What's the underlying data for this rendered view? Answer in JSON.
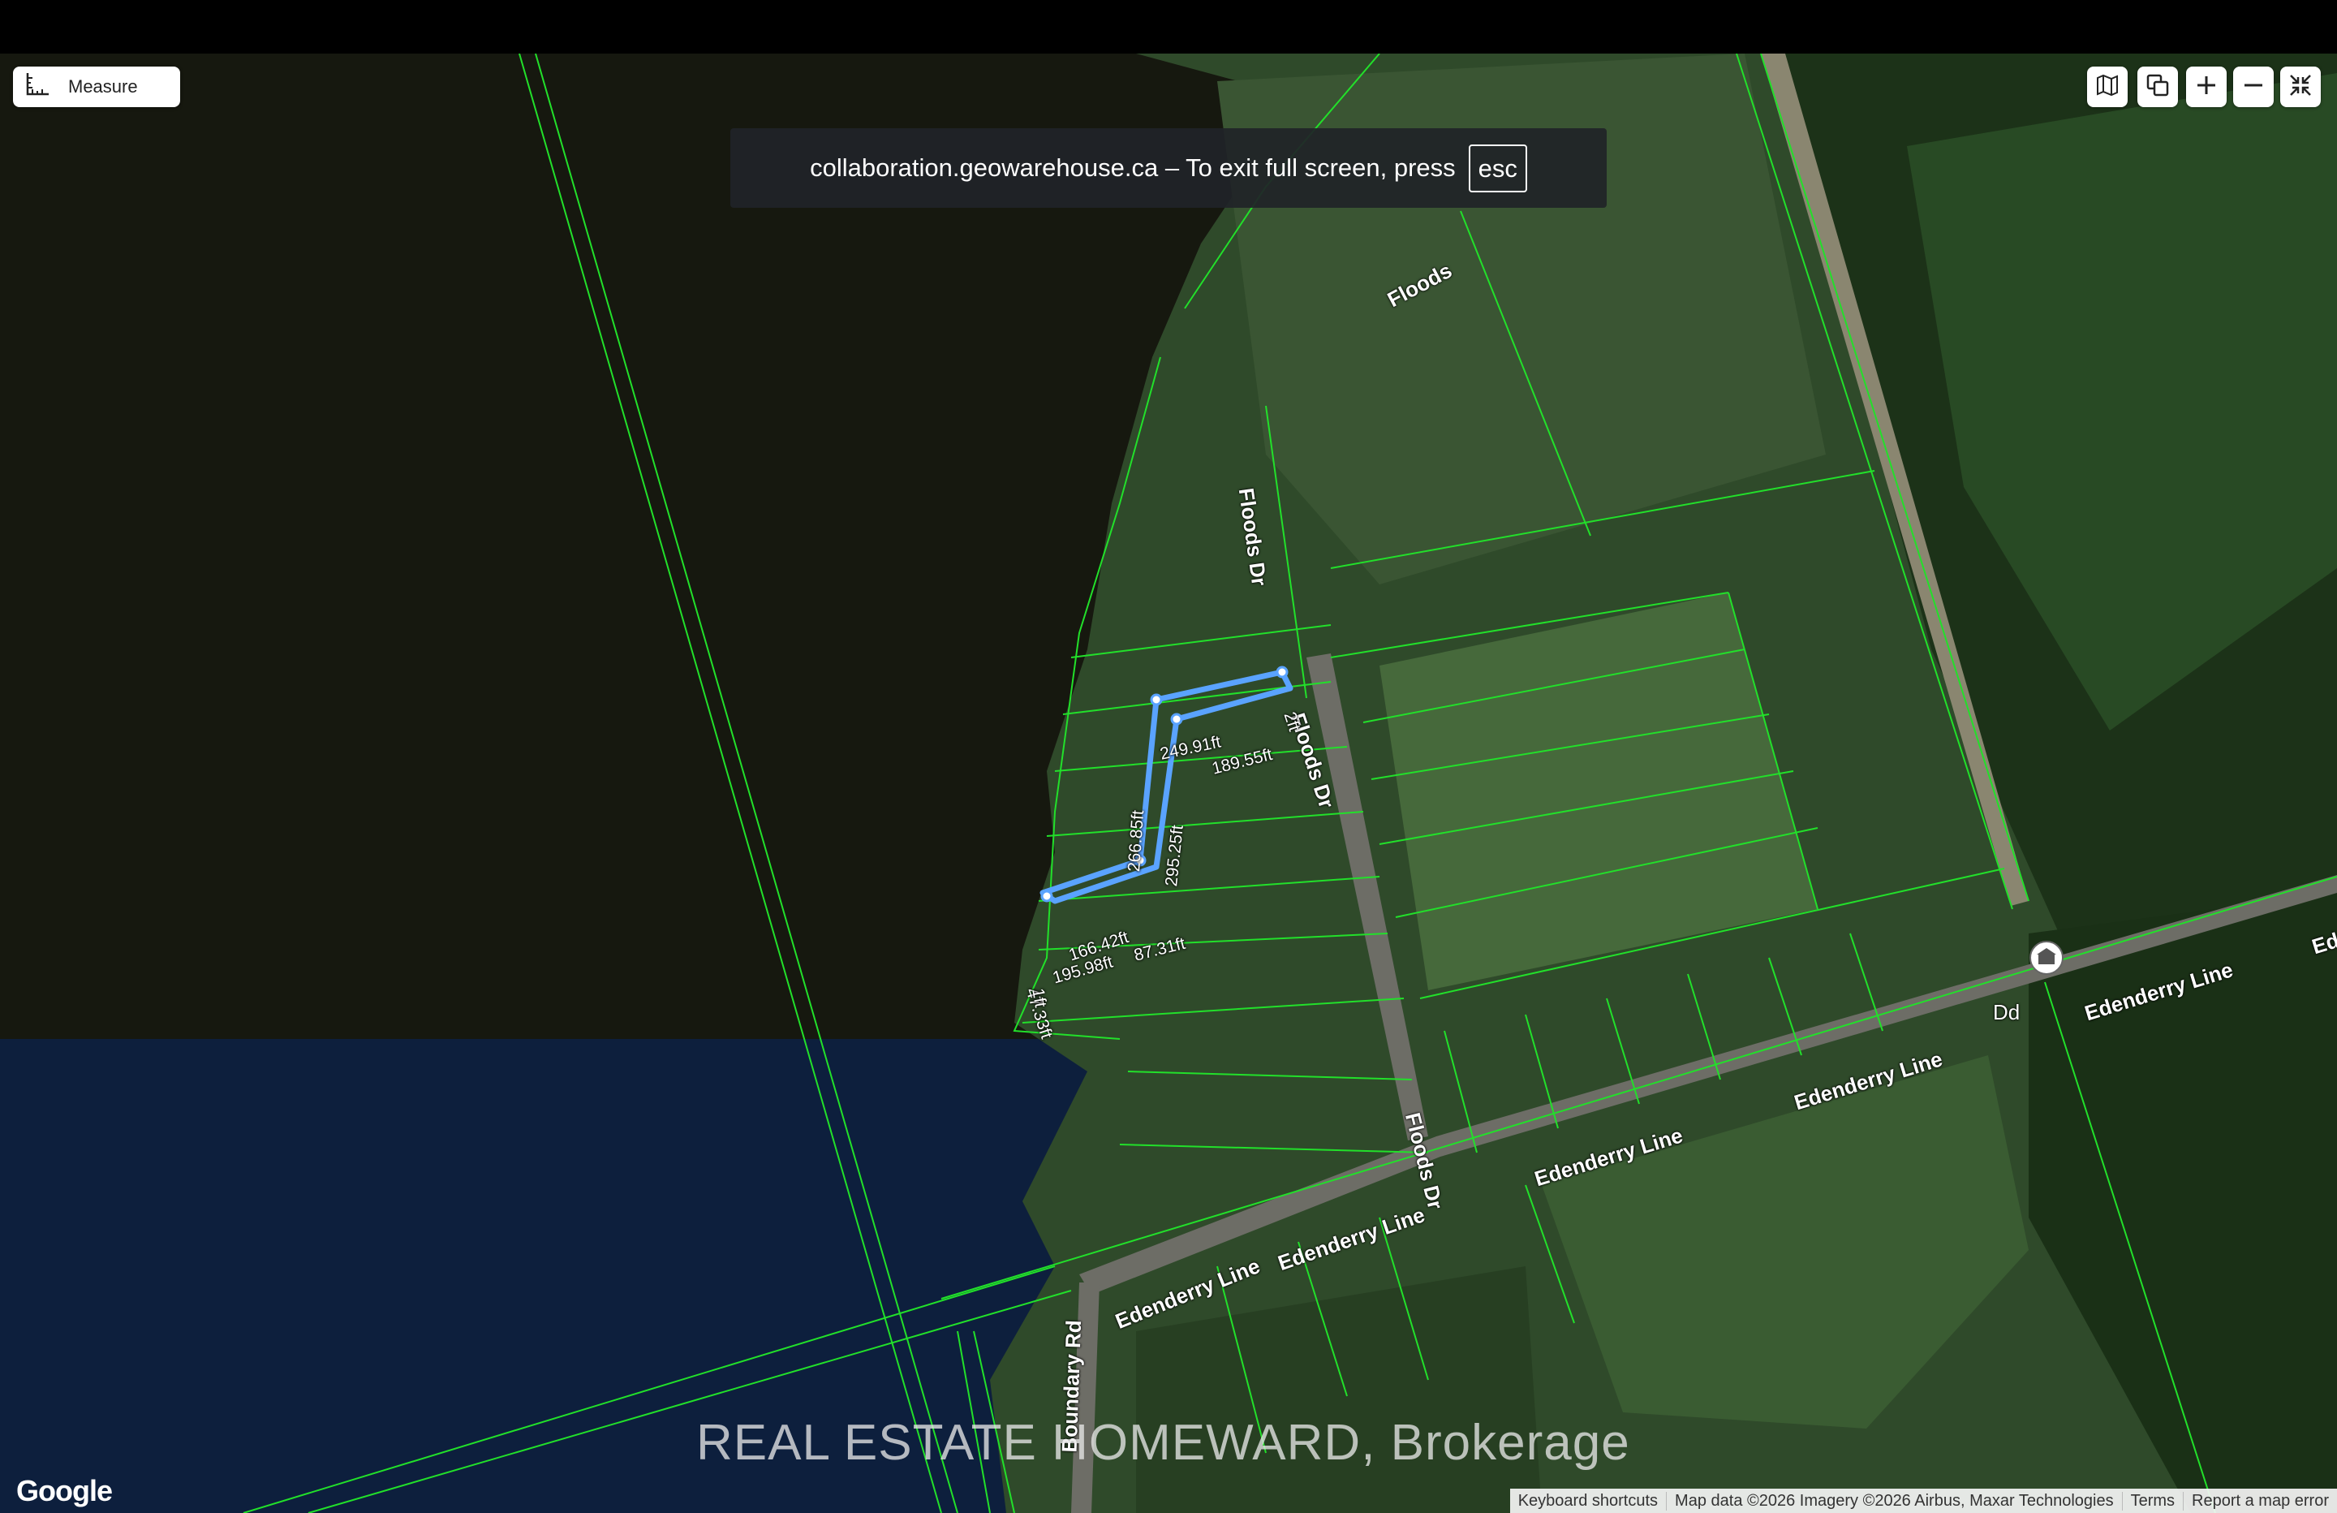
{
  "toolbar": {
    "measure_label": "Measure"
  },
  "map_controls": {
    "items": [
      {
        "name": "map-type-icon"
      },
      {
        "name": "layers-icon"
      },
      {
        "name": "zoom-in-icon"
      },
      {
        "name": "zoom-out-icon"
      },
      {
        "name": "exit-fullscreen-icon"
      }
    ]
  },
  "fullscreen_notice": {
    "text": "collaboration.geowarehouse.ca – To exit full screen, press",
    "key": "esc"
  },
  "roads": {
    "floods_top": "Floods",
    "floods_dr_1": "Floods Dr",
    "floods_dr_2": "Floods Dr",
    "floods_dr_3": "Floods Dr",
    "edenderry_1": "Edenderry Line",
    "edenderry_2": "Edenderry Line",
    "edenderry_3": "Edenderry Line",
    "edenderry_4": "Edenderry Line",
    "edenderry_5": "Edenderry Line",
    "edenderry_6": "Ed",
    "boundary_rd": "Boundary Rd",
    "poi_label": "Dd"
  },
  "measurements": {
    "m1": "249.91ft",
    "m2": "189.55ft",
    "m3": "266.85ft",
    "m4": "295.25ft",
    "m5": "166.42ft",
    "m6": "195.98ft",
    "m7": "87.31ft",
    "m8": "47.33ft",
    "m9": "2ft",
    "m10": "1ft"
  },
  "watermark": "REAL ESTATE HOMEWARD, Brokerage",
  "google_logo": "Google",
  "attribution": {
    "shortcuts": "Keyboard shortcuts",
    "map_data": "Map data ©2026 Imagery ©2026 Airbus, Maxar Technologies",
    "terms": "Terms",
    "report": "Report a map error"
  },
  "colors": {
    "parcel_lines": "#22e02a",
    "measure_line": "#5aa3ff",
    "water": "#0b1d3a",
    "land": "#2f4a2a"
  }
}
